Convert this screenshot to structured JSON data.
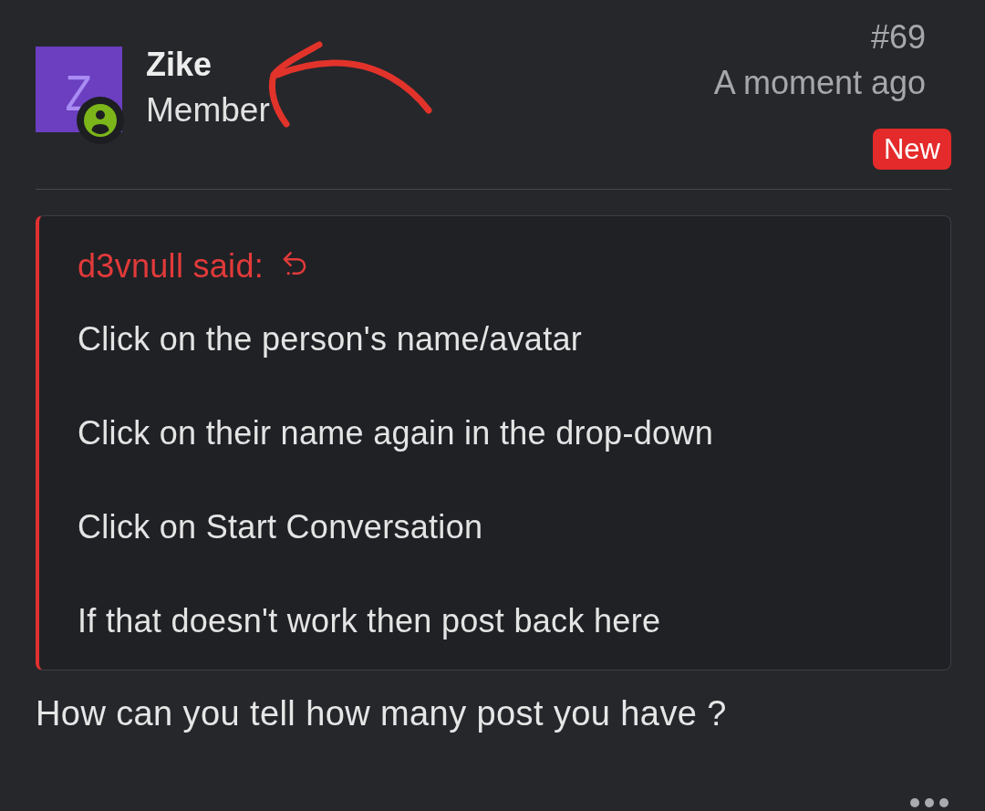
{
  "post": {
    "author": {
      "initial": "Z",
      "name": "Zike",
      "role": "Member",
      "online": true
    },
    "number": "#69",
    "time": "A moment ago",
    "badge": "New"
  },
  "quote": {
    "author": "d3vnull said:",
    "paragraphs": [
      "Click on the person's name/avatar",
      "Click on their name again in the drop-down",
      "Click on Start Conversation",
      "If that doesn't work then post back here"
    ]
  },
  "message": "How can you tell how many post you have ?"
}
